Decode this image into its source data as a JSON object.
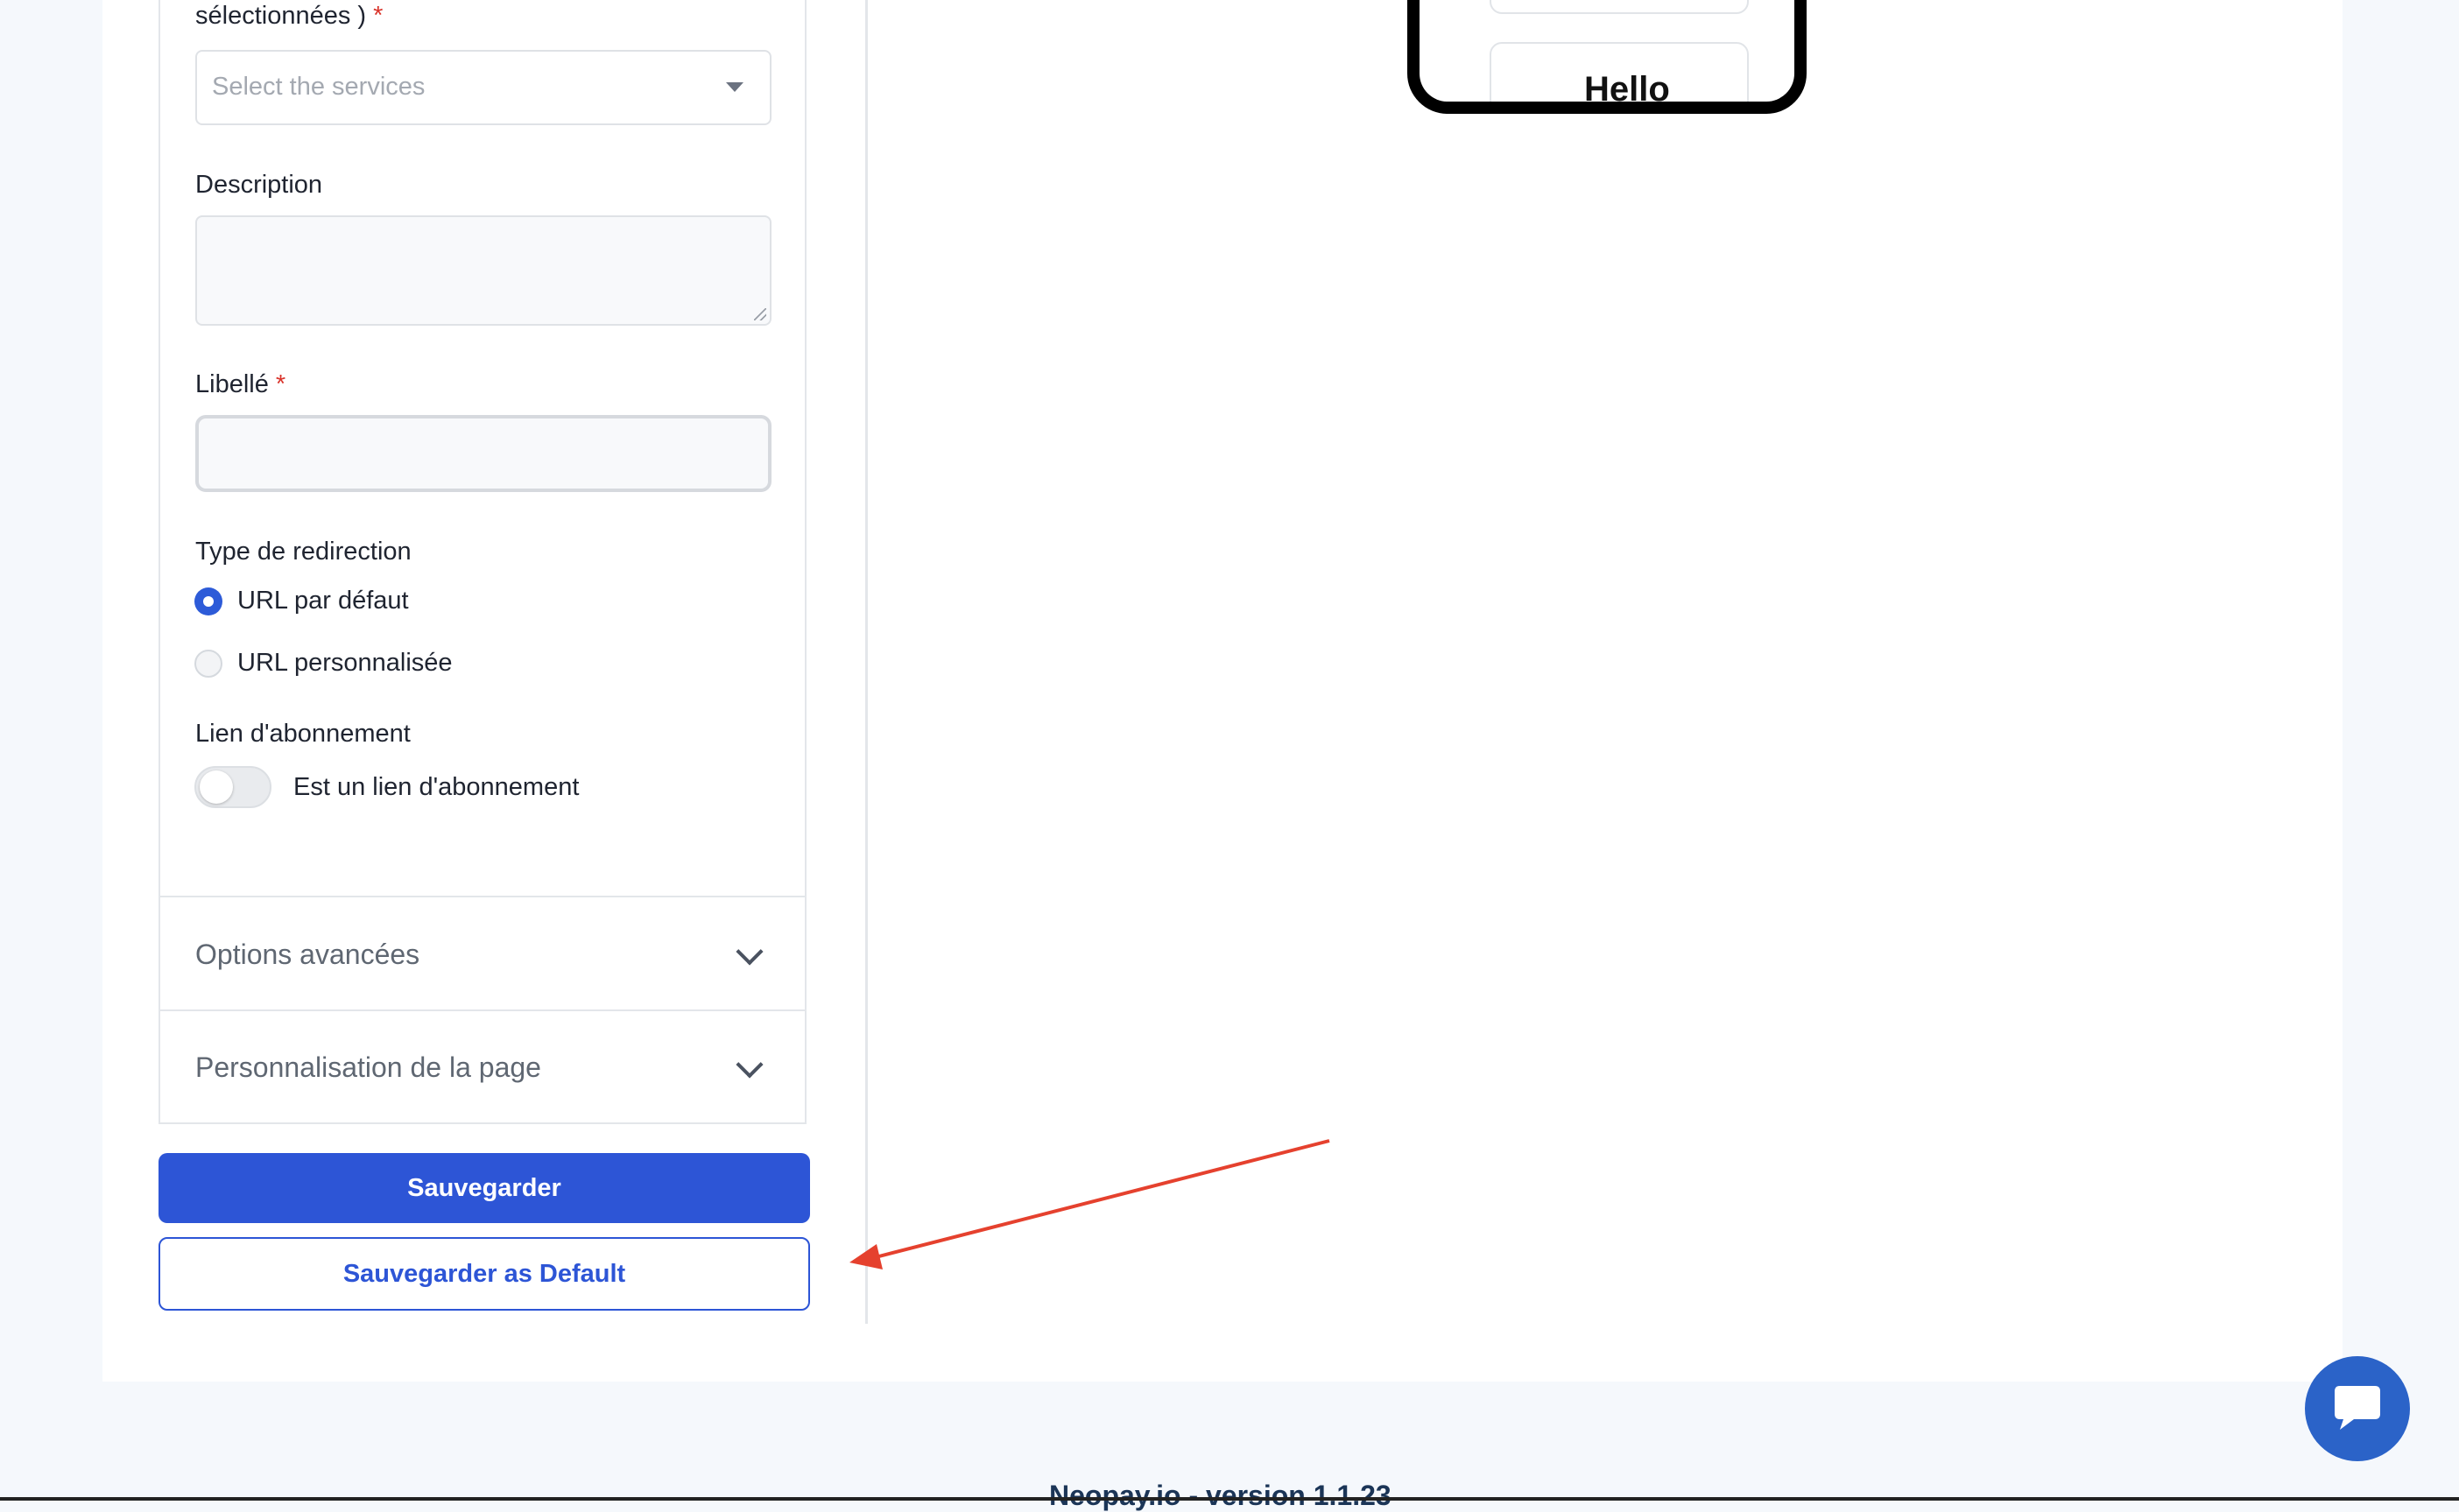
{
  "form": {
    "services": {
      "label_tail": "sélectionnées )",
      "required_mark": "*",
      "placeholder": "Select the services"
    },
    "description": {
      "label": "Description",
      "value": ""
    },
    "libelle": {
      "label": "Libellé",
      "required_mark": "*",
      "value": ""
    },
    "redirection": {
      "label": "Type de redirection",
      "options": [
        {
          "label": "URL par défaut",
          "selected": true
        },
        {
          "label": "URL personnalisée",
          "selected": false
        }
      ]
    },
    "subscription": {
      "label": "Lien d'abonnement",
      "toggle_label": "Est un lien d'abonnement",
      "enabled": false
    },
    "accordions": [
      {
        "label": "Options avancées"
      },
      {
        "label": "Personnalisation de la page"
      }
    ],
    "save_label": "Sauvegarder",
    "save_default_label": "Sauvegarder as Default"
  },
  "preview": {
    "text": "Hello"
  },
  "footer": {
    "text": "Neopay.io - version 1.1.23"
  },
  "colors": {
    "primary": "#2d55d6",
    "required": "#d9342b",
    "annotation_arrow": "#e5412e",
    "chat": "#2b63c8"
  },
  "icons": {
    "select_caret": "caret-down-icon",
    "accordion": "chevron-down-icon",
    "chat": "chat-bubble-icon"
  }
}
